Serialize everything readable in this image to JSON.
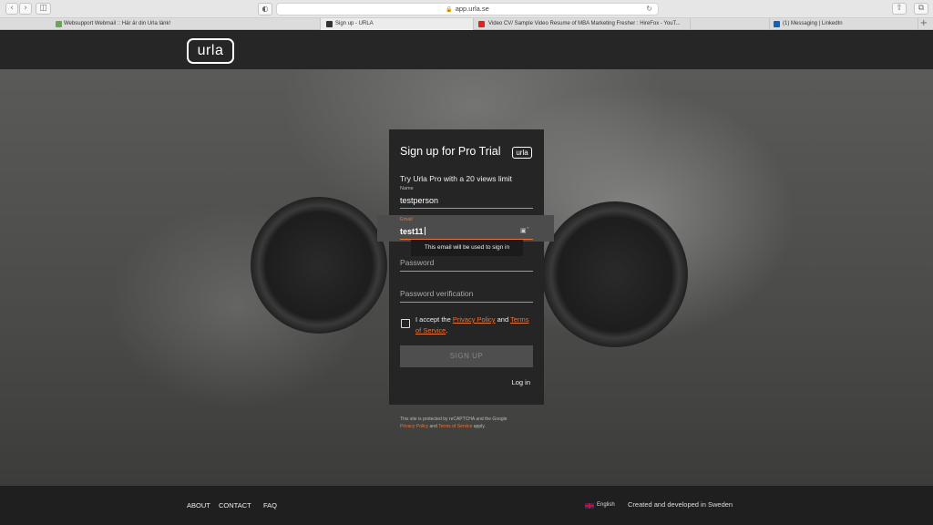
{
  "browser": {
    "url": "app.urla.se",
    "lock_icon": "lock-icon",
    "tabs": [
      {
        "label": "Websupport Webmail :: Här är din Urla länk!",
        "favicon_color": "#6aa84f"
      },
      {
        "label": "Sign up - URLA",
        "favicon_color": "#333333"
      },
      {
        "label": "Video CV/ Sample Video Resume of MBA Marketing Fresher : HireFox - YouT...",
        "favicon_color": "#e62117"
      },
      {
        "label": "(1) Messaging | LinkedIn",
        "favicon_color": "#0a66c2"
      }
    ],
    "new_tab": "+"
  },
  "header": {
    "logo_text": "urla"
  },
  "form": {
    "title": "Sign up for Pro Trial",
    "badge": "urla",
    "subtitle": "Try Urla Pro with a 20 views limit",
    "name_label": "Name",
    "name_value": "testperson",
    "email_label": "Email",
    "email_value": "test11",
    "email_tooltip": "This email will be used to sign in",
    "password_placeholder": "Password",
    "password_verify_placeholder": "Password verification",
    "accept_prefix": "I accept the ",
    "privacy_link": "Privacy Policy",
    "and_text": " and ",
    "terms_link": "Terms of Service",
    "period": ".",
    "signup_button": "SIGN UP",
    "login_link": "Log in"
  },
  "recaptcha": {
    "line1": "This site is protected by reCAPTCHA and the Google",
    "privacy": "Privacy Policy",
    "and": " and ",
    "terms": "Terms of Service",
    "apply": " apply."
  },
  "footer": {
    "about": "ABOUT",
    "contact": "CONTACT",
    "faq": "FAQ",
    "language": "English",
    "credits": "Created and developed in Sweden"
  },
  "colors": {
    "accent": "#e8743a",
    "card": "#252525",
    "header": "#262626"
  }
}
